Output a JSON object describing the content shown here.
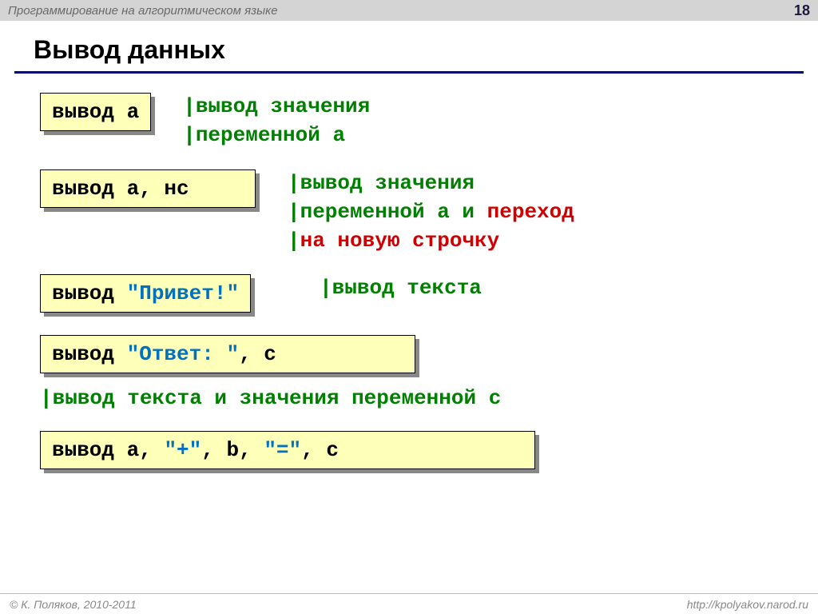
{
  "header": {
    "title": "Программирование на алгоритмическом языке",
    "page_number": "18"
  },
  "slide": {
    "title": "Вывод данных"
  },
  "rows": [
    {
      "code": [
        {
          "t": "вывод а",
          "c": "black"
        }
      ],
      "desc": [
        [
          {
            "t": "|вывод значения",
            "c": "green"
          }
        ],
        [
          {
            "t": "|переменной a",
            "c": "green"
          }
        ]
      ]
    },
    {
      "code": [
        {
          "t": "вывод а, нс",
          "c": "black"
        }
      ],
      "desc": [
        [
          {
            "t": "|вывод значения",
            "c": "green"
          }
        ],
        [
          {
            "t": "|переменной a и ",
            "c": "green"
          },
          {
            "t": "переход",
            "c": "red"
          }
        ],
        [
          {
            "t": "|",
            "c": "green"
          },
          {
            "t": "на новую строчку",
            "c": "red"
          }
        ]
      ]
    },
    {
      "code": [
        {
          "t": "вывод ",
          "c": "black"
        },
        {
          "t": "\"Привет!\"",
          "c": "blue"
        }
      ],
      "desc": [
        [
          {
            "t": "|вывод текста",
            "c": "green"
          }
        ]
      ]
    },
    {
      "code": [
        {
          "t": "вывод ",
          "c": "black"
        },
        {
          "t": "\"Ответ: \"",
          "c": "blue"
        },
        {
          "t": ", c",
          "c": "black"
        }
      ],
      "desc": [
        [
          {
            "t": "|вывод текста и значения переменной c",
            "c": "green"
          }
        ]
      ]
    },
    {
      "code": [
        {
          "t": "вывод ",
          "c": "black"
        },
        {
          "t": "a",
          "c": "black"
        },
        {
          "t": ", ",
          "c": "black"
        },
        {
          "t": "\"+\"",
          "c": "blue"
        },
        {
          "t": ", ",
          "c": "black"
        },
        {
          "t": "b",
          "c": "black"
        },
        {
          "t": ", ",
          "c": "black"
        },
        {
          "t": "\"=\"",
          "c": "blue"
        },
        {
          "t": ", ",
          "c": "black"
        },
        {
          "t": "c",
          "c": "black"
        }
      ],
      "desc": []
    }
  ],
  "footer": {
    "left": "© К. Поляков, 2010-2011",
    "right": "http://kpolyakov.narod.ru"
  }
}
